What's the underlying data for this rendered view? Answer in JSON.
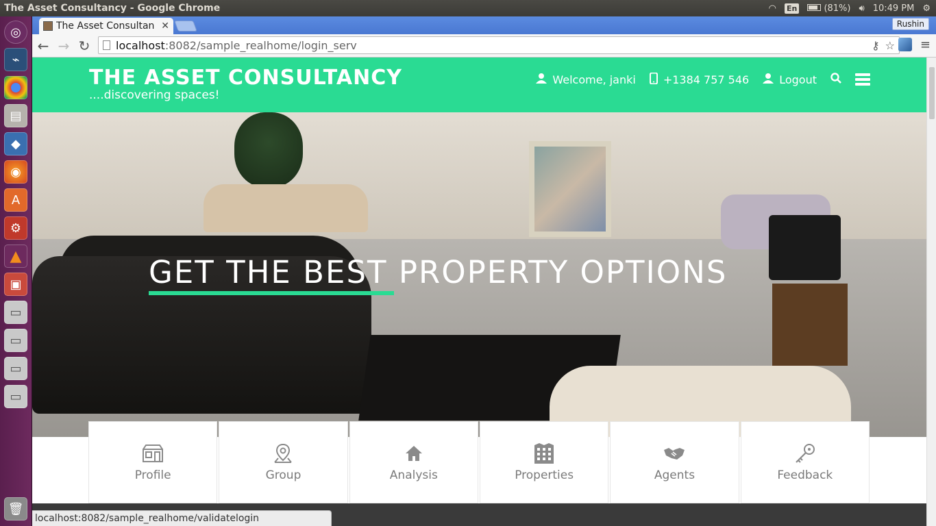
{
  "os": {
    "window_title": "The Asset Consultancy - Google Chrome",
    "language": "En",
    "battery": "(81%)",
    "clock": "10:49 PM"
  },
  "browser": {
    "tab_title": "The Asset Consultan",
    "profile_name": "Rushin",
    "url_host": "localhost",
    "url_path": ":8082/sample_realhome/login_serv",
    "status_url": "localhost:8082/sample_realhome/validatelogin"
  },
  "site": {
    "brand_title": "THE ASSET CONSULTANCY",
    "brand_tagline": "....discovering spaces!",
    "nav": {
      "welcome": "Welcome, janki",
      "phone": "+1384 757 546",
      "logout": "Logout"
    },
    "hero_headline": "GET THE BEST PROPERTY OPTIONS",
    "features": [
      {
        "label": "Profile",
        "icon": "storefront-icon"
      },
      {
        "label": "Group",
        "icon": "map-pin-icon"
      },
      {
        "label": "Analysis",
        "icon": "home-icon"
      },
      {
        "label": "Properties",
        "icon": "building-icon"
      },
      {
        "label": "Agents",
        "icon": "handshake-icon"
      },
      {
        "label": "Feedback",
        "icon": "key-icon"
      }
    ],
    "colors": {
      "brand_green": "#2adb93",
      "feature_text": "#7a7a7a"
    }
  }
}
